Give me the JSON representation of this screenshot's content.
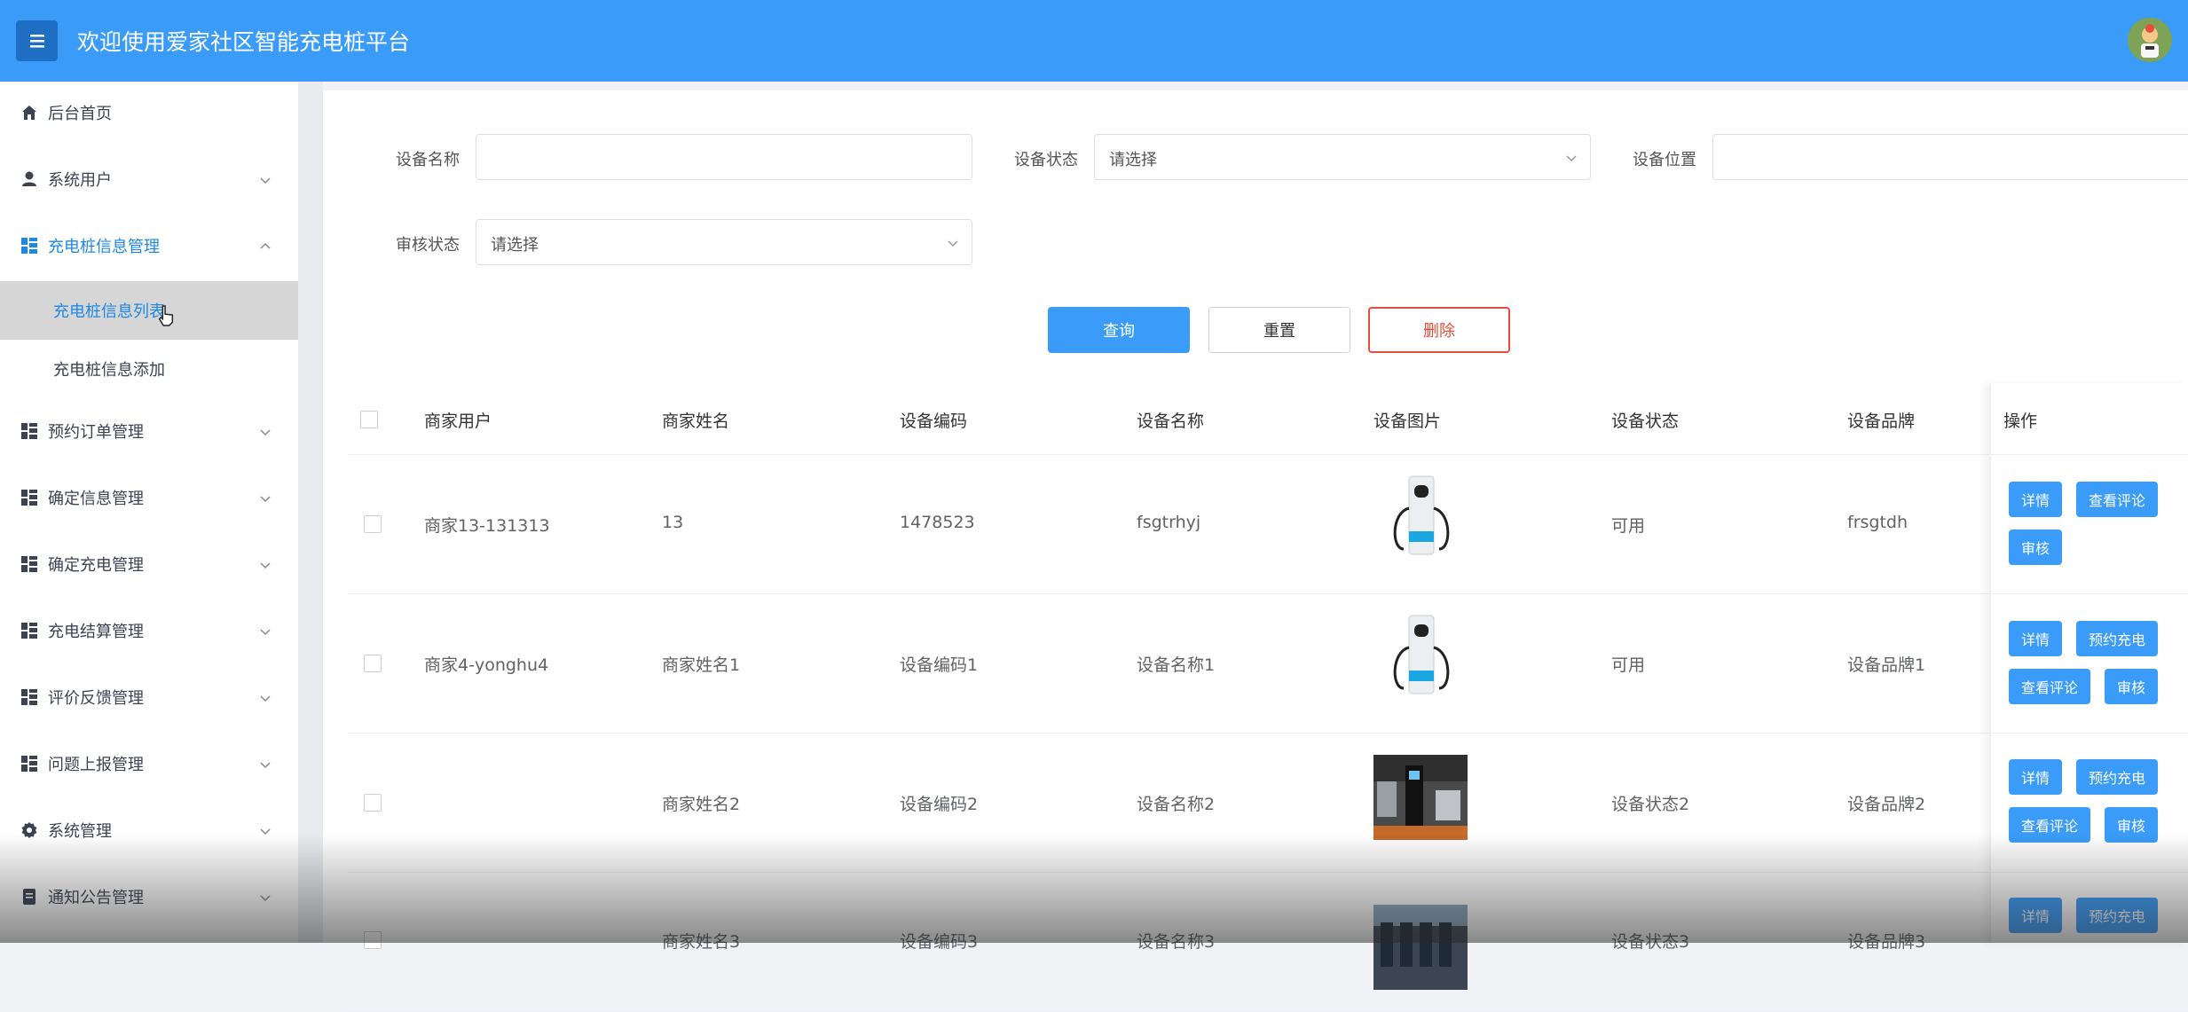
{
  "header": {
    "title": "欢迎使用爱家社区智能充电桩平台",
    "menu_icon": "hamburger-icon",
    "avatar_icon": "avatar"
  },
  "sidebar": {
    "items": [
      {
        "label": "后台首页",
        "icon": "home-icon"
      },
      {
        "label": "系统用户",
        "icon": "user-icon"
      },
      {
        "label": "充电桩信息管理",
        "icon": "grid-icon"
      },
      {
        "label": "预约订单管理",
        "icon": "grid-icon"
      },
      {
        "label": "确定信息管理",
        "icon": "grid-icon"
      },
      {
        "label": "确定充电管理",
        "icon": "grid-icon"
      },
      {
        "label": "充电结算管理",
        "icon": "grid-icon"
      },
      {
        "label": "评价反馈管理",
        "icon": "grid-icon"
      },
      {
        "label": "问题上报管理",
        "icon": "grid-icon"
      },
      {
        "label": "系统管理",
        "icon": "gear-icon"
      },
      {
        "label": "通知公告管理",
        "icon": "document-icon"
      }
    ],
    "subitems": [
      {
        "label": "充电桩信息列表"
      },
      {
        "label": "充电桩信息添加"
      }
    ]
  },
  "filters": {
    "device_name_label": "设备名称",
    "device_name_value": "",
    "device_status_label": "设备状态",
    "device_status_placeholder": "请选择",
    "device_location_label": "设备位置",
    "device_location_value": "",
    "review_status_label": "审核状态",
    "review_status_placeholder": "请选择"
  },
  "actions": {
    "search": "查询",
    "reset": "重置",
    "delete": "删除"
  },
  "table": {
    "columns": [
      "商家用户",
      "商家姓名",
      "设备编码",
      "设备名称",
      "设备图片",
      "设备状态",
      "设备品牌",
      "操作"
    ],
    "rows": [
      {
        "merchant_user": "商家13-131313",
        "merchant_name": "13",
        "device_code": "1478523",
        "device_name": "fsgtrhyj",
        "image": "charger-white",
        "status": "可用",
        "brand": "frsgtdh",
        "ops": [
          "详情",
          "查看评论",
          "审核"
        ]
      },
      {
        "merchant_user": "商家4-yonghu4",
        "merchant_name": "商家姓名1",
        "device_code": "设备编码1",
        "device_name": "设备名称1",
        "image": "charger-white",
        "status": "可用",
        "brand": "设备品牌1",
        "ops": [
          "详情",
          "预约充电",
          "查看评论",
          "审核"
        ]
      },
      {
        "merchant_user": "",
        "merchant_name": "商家姓名2",
        "device_code": "设备编码2",
        "device_name": "设备名称2",
        "image": "charger-photo",
        "status": "设备状态2",
        "brand": "设备品牌2",
        "ops": [
          "详情",
          "预约充电",
          "查看评论",
          "审核"
        ]
      },
      {
        "merchant_user": "",
        "merchant_name": "商家姓名3",
        "device_code": "设备编码3",
        "device_name": "设备名称3",
        "image": "charger-photo-2",
        "status": "设备状态3",
        "brand": "设备品牌3",
        "ops": [
          "详情",
          "预约充电"
        ]
      }
    ]
  },
  "colors": {
    "accent": "#3a9cf8",
    "danger": "#e74c3c",
    "active_text": "#1e88e5"
  }
}
